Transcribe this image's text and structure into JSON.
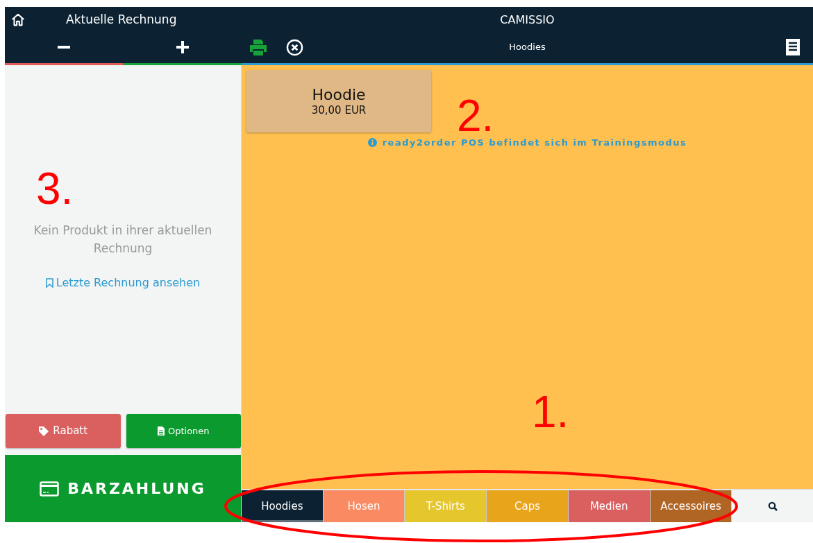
{
  "header": {
    "title": "Aktuelle Rechnung",
    "brand": "CAMISSIO",
    "category": "Hoodies"
  },
  "receipt": {
    "empty_text": "Kein Produkt in ihrer aktuellen Rechnung",
    "last_link": "Letzte Rechnung ansehen"
  },
  "actions": [
    {
      "kind": "discount",
      "label": "Rabatt"
    },
    {
      "kind": "options",
      "label": "Optionen"
    }
  ],
  "pay_button": "BARZAHLUNG",
  "products": [
    {
      "name": "Hoodie",
      "price": "30,00 EUR"
    }
  ],
  "notice": "ready2order POS befindet sich im Trainingsmodus",
  "categories": [
    {
      "label": "Hoodies",
      "color": "#0c2233",
      "selected": true
    },
    {
      "label": "Hosen",
      "color": "#fa8a62",
      "selected": false
    },
    {
      "label": "T-Shirts",
      "color": "#e5c62d",
      "selected": false
    },
    {
      "label": "Caps",
      "color": "#e8a41a",
      "selected": false
    },
    {
      "label": "Medien",
      "color": "#da6060",
      "selected": false
    },
    {
      "label": "Accessoires",
      "color": "#b06525",
      "selected": false
    }
  ],
  "annotations": [
    "3.",
    "2.",
    "1."
  ]
}
